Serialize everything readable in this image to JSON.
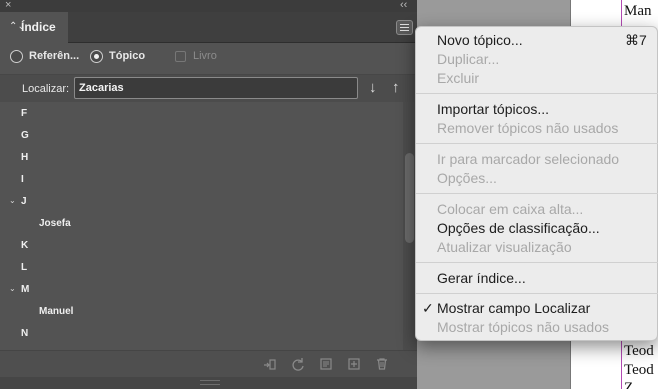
{
  "window": {
    "close_glyph": "×",
    "collapse_glyph": "‹‹"
  },
  "panel": {
    "tab_title": "Índice",
    "tab_chevrons": "⌃⌄",
    "menu_icon": "hamburger-icon"
  },
  "mode": {
    "references_label": "Referên...",
    "topic_label": "Tópico",
    "book_label": "Livro",
    "selected": "topic"
  },
  "search": {
    "label": "Localizar:",
    "value": "Zacarias",
    "next_glyph": "↓",
    "prev_glyph": "↑"
  },
  "topics": [
    {
      "label": "F",
      "expanded": false
    },
    {
      "label": "G",
      "expanded": false
    },
    {
      "label": "H",
      "expanded": false
    },
    {
      "label": "I",
      "expanded": false
    },
    {
      "label": "J",
      "expanded": true
    },
    {
      "label": "Josefa",
      "child": true
    },
    {
      "label": "K",
      "expanded": false
    },
    {
      "label": "L",
      "expanded": false
    },
    {
      "label": "M",
      "expanded": true
    },
    {
      "label": "Manuel",
      "child": true
    },
    {
      "label": "N",
      "expanded": false
    }
  ],
  "twisty_glyph": "⌄",
  "bottom_tools": [
    "goto-topic-icon",
    "refresh-icon",
    "generate-index-icon",
    "new-entry-icon",
    "trash-icon"
  ],
  "menu": {
    "new_topic": "Novo tópico...",
    "new_topic_shortcut": "⌘7",
    "duplicate": "Duplicar...",
    "delete": "Excluir",
    "import_topics": "Importar tópicos...",
    "remove_unused": "Remover tópicos não usados",
    "goto_marker": "Ir para marcador selecionado",
    "options": "Opções...",
    "capitalize": "Colocar em caixa alta...",
    "sort_options": "Opções de classificação...",
    "update_preview": "Atualizar visualização",
    "generate_index": "Gerar índice...",
    "show_find_field": "Mostrar campo Localizar",
    "show_unused": "Mostrar tópicos não usados",
    "checkmark": "✓"
  },
  "document": {
    "word_top": "Man",
    "word_a": "Teod",
    "word_b": "Teod",
    "word_c": "Z"
  }
}
